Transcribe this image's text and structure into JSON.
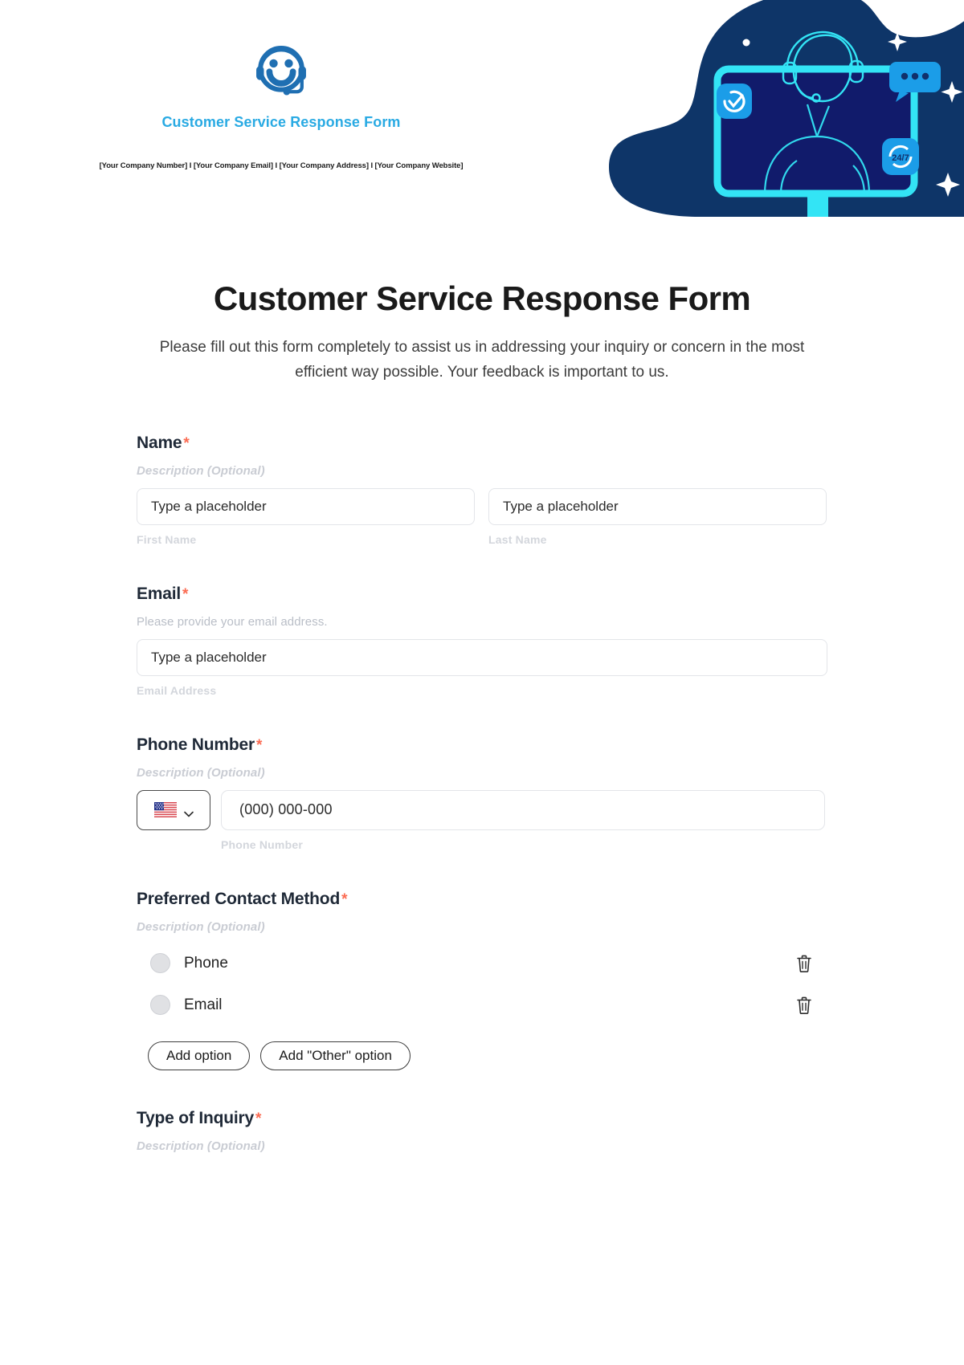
{
  "header": {
    "logo_icon": "headset-smiley-icon",
    "brand_title": "Customer Service Response Form",
    "contact_line": "[Your Company Number] I [Your Company Email] I [Your Company Address] I [Your Company Website]",
    "illustration": "customer-support-agent-illustration",
    "colors": {
      "brand_blue": "#29AAE3",
      "logo_blue": "#1F6FB2",
      "art_navy": "#0E3568",
      "art_deep_navy": "#111B6B",
      "art_cyan": "#33E4F5",
      "art_blue": "#1B9DE8"
    },
    "illustration_badges": [
      "check-badge",
      "chat-bubble-badge",
      "24/7"
    ]
  },
  "form": {
    "title": "Customer Service Response Form",
    "description": "Please fill out this form completely to assist us in addressing your inquiry or concern in the most efficient way possible. Your feedback is important to us.",
    "required_marker": "*",
    "fields": [
      {
        "label": "Name",
        "required": true,
        "hint": "Description (Optional)",
        "hint_style": "italic",
        "inputs": [
          {
            "placeholder": "Type a placeholder",
            "sublabel": "First Name"
          },
          {
            "placeholder": "Type a placeholder",
            "sublabel": "Last Name"
          }
        ]
      },
      {
        "label": "Email",
        "required": true,
        "hint": "Please provide your email address.",
        "hint_style": "plain",
        "inputs": [
          {
            "placeholder": "Type a placeholder",
            "sublabel": "Email Address"
          }
        ]
      },
      {
        "label": "Phone Number",
        "required": true,
        "hint": "Description (Optional)",
        "hint_style": "italic",
        "country_flag": "us-flag-icon",
        "dropdown_icon": "chevron-down-icon",
        "inputs": [
          {
            "placeholder": "(000) 000-000",
            "sublabel": "Phone Number"
          }
        ]
      },
      {
        "label": "Preferred Contact Method",
        "required": true,
        "hint": "Description (Optional)",
        "hint_style": "italic",
        "options": [
          {
            "label": "Phone",
            "delete_icon": "trash-icon"
          },
          {
            "label": "Email",
            "delete_icon": "trash-icon"
          }
        ],
        "buttons": [
          {
            "label": "Add option"
          },
          {
            "label": "Add \"Other\" option"
          }
        ]
      },
      {
        "label": "Type of Inquiry",
        "required": true,
        "hint": "Description (Optional)",
        "hint_style": "italic"
      }
    ]
  }
}
